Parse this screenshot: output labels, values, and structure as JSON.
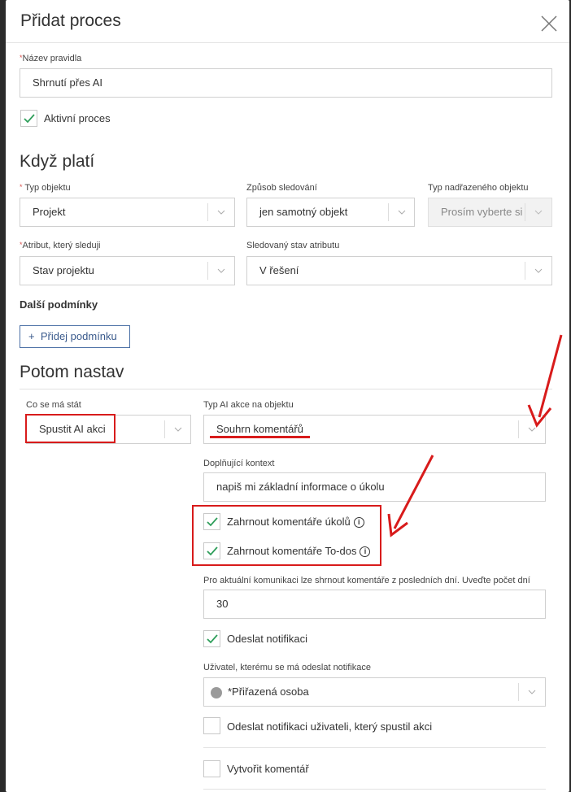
{
  "header": {
    "title": "Přidat proces"
  },
  "rule": {
    "name_label": "Název pravidla",
    "name_value": "Shrnutí přes AI",
    "active_label": "Aktivní proces"
  },
  "when": {
    "title": "Když platí",
    "object_type_label": "Typ objektu",
    "object_type_value": "Projekt",
    "tracking_label": "Způsob sledování",
    "tracking_value": "jen samotný objekt",
    "parent_label": "Typ nadřazeného objektu",
    "parent_value": "Prosím vyberte si",
    "attribute_label": "Atribut, který sleduji",
    "attribute_value": "Stav projektu",
    "state_label": "Sledovaný stav atributu",
    "state_value": "V řešení",
    "more_title": "Další podmínky",
    "add_condition": "Přidej podmínku"
  },
  "then": {
    "title": "Potom nastav",
    "what_label": "Co se má stát",
    "what_value": "Spustit AI akci",
    "ai_type_label": "Typ AI akce na objektu",
    "ai_type_value": "Souhrn komentářů",
    "context_label": "Doplňující kontext",
    "context_value": "napiš mi základní informace o úkolu",
    "include_tasks": "Zahrnout komentáře úkolů",
    "include_todos": "Zahrnout komentáře To-dos",
    "days_label": "Pro aktuální komunikaci lze shrnout komentáře z posledních dní. Uveďte počet dní",
    "days_value": "30",
    "send_notif": "Odeslat notifikaci",
    "user_label": "Uživatel, kterému se má odeslat notifikace",
    "user_value": "*Přiřazená osoba",
    "notify_trigger": "Odeslat notifikaci uživateli, který spustil akci",
    "create_comment": "Vytvořit komentář"
  },
  "colors": {
    "accent_red": "#d81b1b",
    "check_green": "#2e9e5a",
    "button_blue": "#4a6fa5"
  },
  "icons": [
    "close-icon",
    "chevron-down-icon",
    "checkmark-icon",
    "plus-icon",
    "info-icon",
    "avatar-icon",
    "arrow-icon"
  ]
}
